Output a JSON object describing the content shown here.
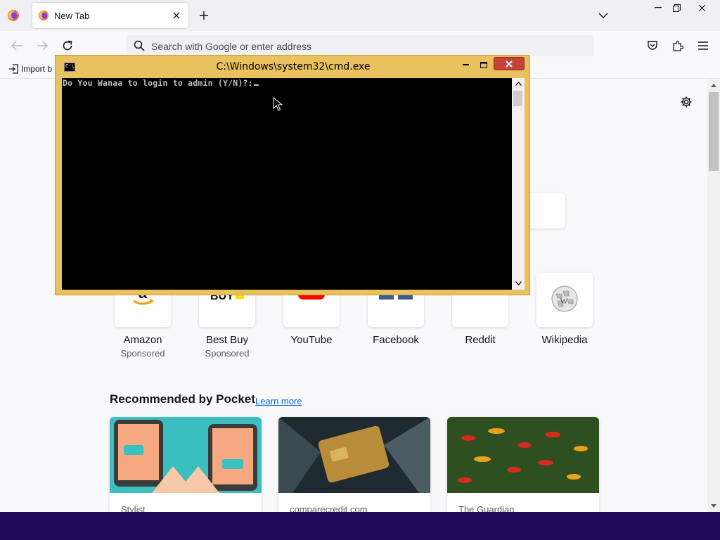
{
  "browser": {
    "tab": {
      "title": "New Tab"
    },
    "urlbar": {
      "placeholder": "Search with Google or enter address"
    },
    "bookmarks": {
      "import_label": "Import b"
    }
  },
  "newtab": {
    "shortcuts": [
      {
        "name": "Amazon",
        "sponsored": "Sponsored"
      },
      {
        "name": "Best Buy",
        "sponsored": "Sponsored"
      },
      {
        "name": "YouTube",
        "sponsored": ""
      },
      {
        "name": "Facebook",
        "sponsored": ""
      },
      {
        "name": "Reddit",
        "sponsored": ""
      },
      {
        "name": "Wikipedia",
        "sponsored": ""
      }
    ],
    "pocket": {
      "heading": "Recommended by Pocket",
      "learn_more": "Learn more",
      "cards": [
        {
          "source": "Stylist"
        },
        {
          "source": "comparecredit.com"
        },
        {
          "source": "The Guardian"
        }
      ]
    }
  },
  "cmd": {
    "icon_text": "C:\\.",
    "title": "C:\\Windows\\system32\\cmd.exe",
    "console_text": "Do You Wanaa to login to admin (Y/N)?:"
  },
  "colors": {
    "cmd_frame": "#e9c15f",
    "cmd_close": "#c7433a",
    "taskbar": "#1f0a5e",
    "link": "#0061e0"
  },
  "icons": {
    "browser": "firefox-icon",
    "nav": [
      "back-arrow-icon",
      "forward-arrow-icon",
      "reload-icon"
    ],
    "toolbar": [
      "pocket-save-icon",
      "extensions-icon",
      "hamburger-menu-icon"
    ]
  }
}
